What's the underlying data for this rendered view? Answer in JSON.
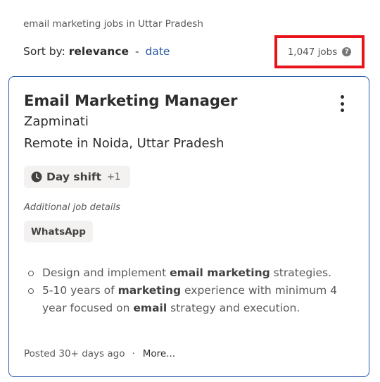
{
  "breadcrumb": "email marketing jobs in Uttar Pradesh",
  "sort": {
    "prefix": "Sort by:",
    "active": "relevance",
    "separator": "-",
    "alternate": "date"
  },
  "job_count": {
    "text": "1,047 jobs",
    "help_glyph": "?",
    "highlight_color": "#e8131b"
  },
  "job": {
    "title": "Email Marketing Manager",
    "company": "Zapminati",
    "location": "Remote in Noida, Uttar Pradesh",
    "shift": {
      "label": "Day shift",
      "extra": "+1",
      "icon": "clock-icon"
    },
    "additional_label": "Additional job details",
    "detail_tag": "WhatsApp",
    "snippet": [
      {
        "parts": [
          {
            "text": "Design and implement ",
            "bold": false
          },
          {
            "text": "email marketing",
            "bold": true
          },
          {
            "text": " strategies.",
            "bold": false
          }
        ]
      },
      {
        "parts": [
          {
            "text": "5-10 years of ",
            "bold": false
          },
          {
            "text": "marketing",
            "bold": true
          },
          {
            "text": " experience with minimum 4 year focused on ",
            "bold": false
          },
          {
            "text": "email",
            "bold": true
          },
          {
            "text": " strategy and execution.",
            "bold": false
          }
        ]
      }
    ],
    "posted": "Posted 30+ days ago",
    "dot": "·",
    "more": "More..."
  },
  "colors": {
    "link": "#2557a7",
    "card_border": "#2557a7",
    "tag_bg": "#f3f2f1"
  }
}
